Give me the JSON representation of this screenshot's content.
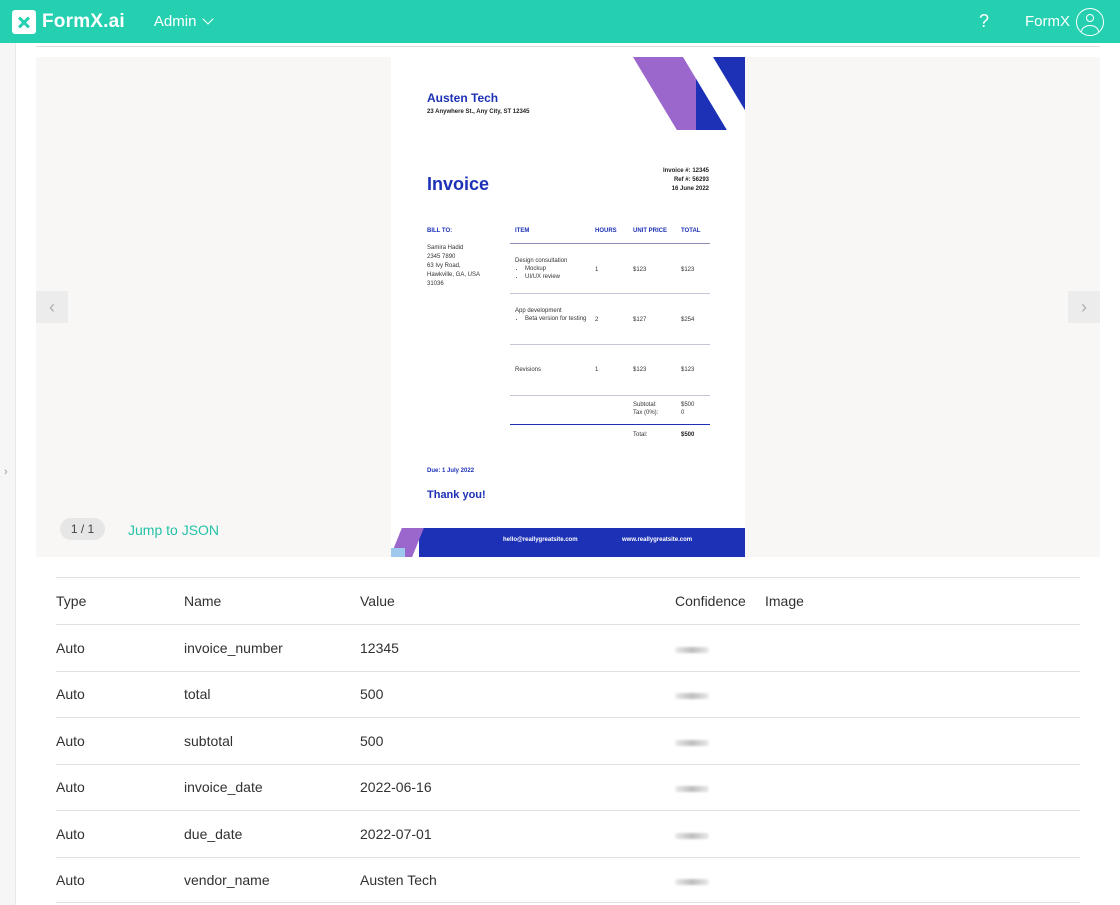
{
  "app": {
    "logo_text": "FormX.ai",
    "menu_label": "Admin",
    "help_label": "?",
    "user_name": "FormX"
  },
  "viewer": {
    "page_indicator": "1 / 1",
    "jump_link": "Jump to JSON",
    "prev_label": "‹",
    "next_label": "›"
  },
  "invoice": {
    "company": "Austen Tech",
    "address": "23 Anywhere St., Any City, ST 12345",
    "title": "Invoice",
    "invoice_no": "Invoice #: 12345",
    "ref_no": "Ref #: 56293",
    "date": "16 June 2022",
    "bill_to_label": "BILL TO:",
    "bill_to_lines": [
      "Samira Hadid",
      "2345 7890",
      "63 Ivy Road,",
      "Hawkville, GA, USA",
      "31036"
    ],
    "headers": {
      "item": "ITEM",
      "hours": "HOURS",
      "unit_price": "UNIT PRICE",
      "total": "TOTAL"
    },
    "items": [
      {
        "name": "Design consultation",
        "bullets": [
          "Mockup",
          "UI/UX review"
        ],
        "hours": "1",
        "unit_price": "$123",
        "total": "$123"
      },
      {
        "name": "App development",
        "bullets": [
          "Beta version for testing"
        ],
        "hours": "2",
        "unit_price": "$127",
        "total": "$254"
      },
      {
        "name": "Revisions",
        "bullets": [],
        "hours": "1",
        "unit_price": "$123",
        "total": "$123"
      }
    ],
    "subtotal_label": "Subtotal:",
    "subtotal_value": "$500",
    "tax_label": "Tax (0%):",
    "tax_value": "0",
    "total_label": "Total:",
    "total_value": "$500",
    "due": "Due: 1 July 2022",
    "thanks": "Thank you!",
    "email": "hello@reallygreatsite.com",
    "website": "www.reallygreatsite.com"
  },
  "results": {
    "headers": {
      "type": "Type",
      "name": "Name",
      "value": "Value",
      "confidence": "Confidence",
      "image": "Image"
    },
    "rows": [
      {
        "type": "Auto",
        "name": "invoice_number",
        "value": "12345"
      },
      {
        "type": "Auto",
        "name": "total",
        "value": "500"
      },
      {
        "type": "Auto",
        "name": "subtotal",
        "value": "500"
      },
      {
        "type": "Auto",
        "name": "invoice_date",
        "value": "2022-06-16"
      },
      {
        "type": "Auto",
        "name": "due_date",
        "value": "2022-07-01"
      },
      {
        "type": "Auto",
        "name": "vendor_name",
        "value": "Austen Tech"
      }
    ]
  },
  "colors": {
    "brand": "#25d0b1",
    "invoice_blue": "#1c31b5",
    "invoice_purple": "#9c67cc"
  }
}
